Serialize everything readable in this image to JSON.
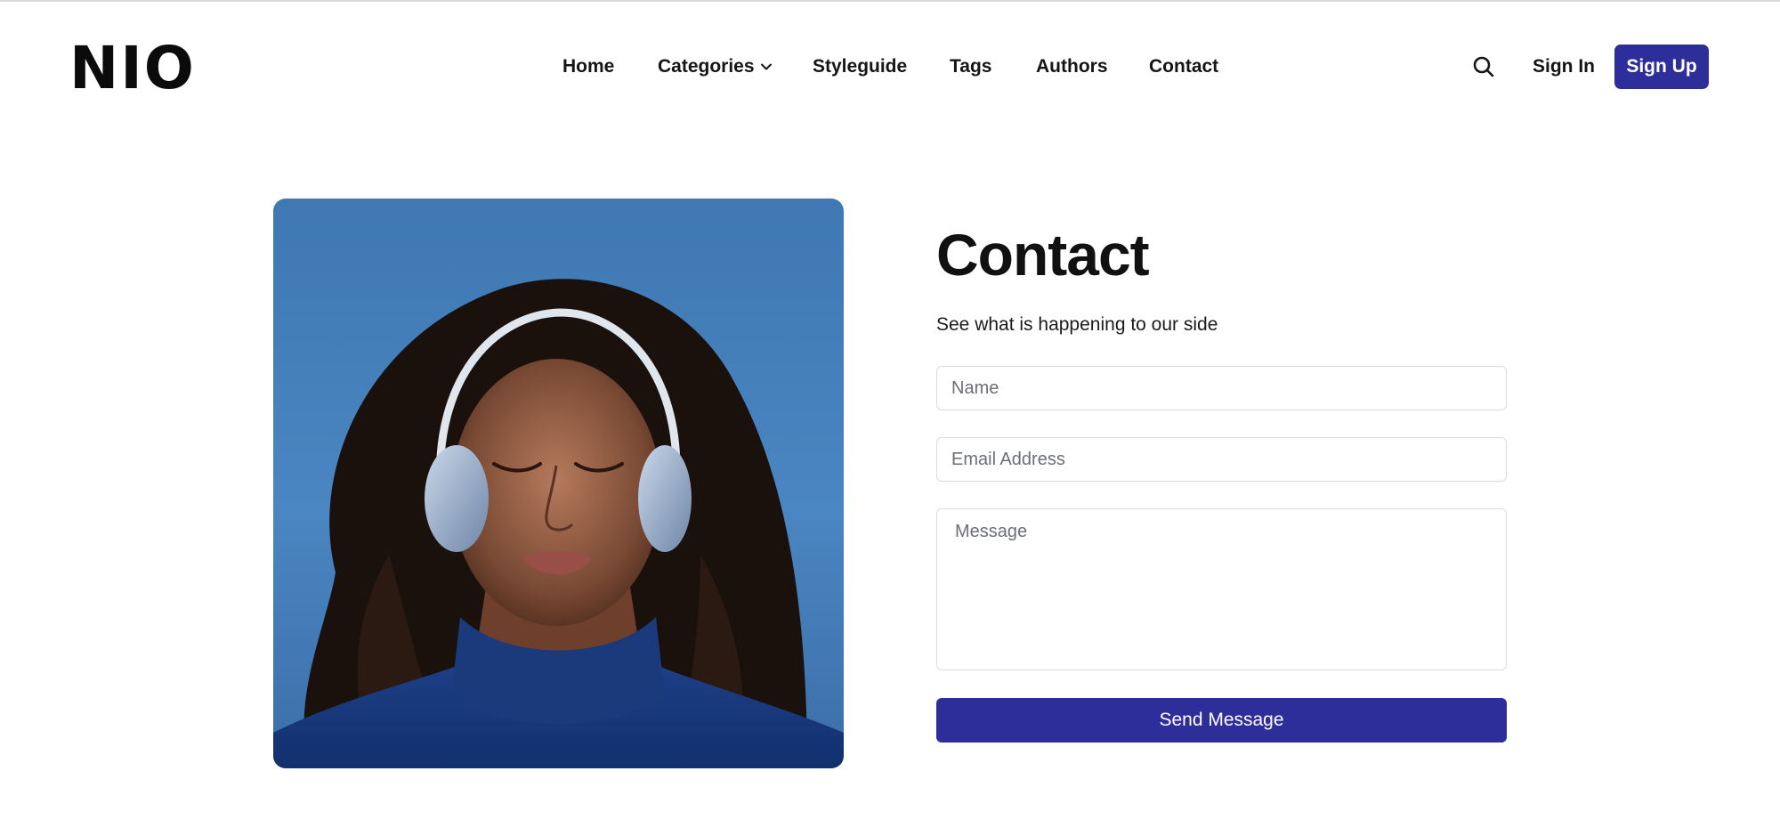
{
  "brand": {
    "logo_text": "NIO"
  },
  "nav": {
    "items": [
      {
        "label": "Home"
      },
      {
        "label": "Categories",
        "has_dropdown": true
      },
      {
        "label": "Styleguide"
      },
      {
        "label": "Tags"
      },
      {
        "label": "Authors"
      },
      {
        "label": "Contact"
      }
    ]
  },
  "header_actions": {
    "search_icon": "search-icon",
    "sign_in_label": "Sign In",
    "sign_up_label": "Sign Up"
  },
  "contact": {
    "title": "Contact",
    "subtitle": "See what is happening to our side",
    "name_placeholder": "Name",
    "email_placeholder": "Email Address",
    "message_placeholder": "Message",
    "submit_label": "Send Message"
  },
  "colors": {
    "accent": "#2e2e9a",
    "text": "#111111",
    "field_border": "#dcdce0",
    "photo_background": "#4580bd"
  }
}
